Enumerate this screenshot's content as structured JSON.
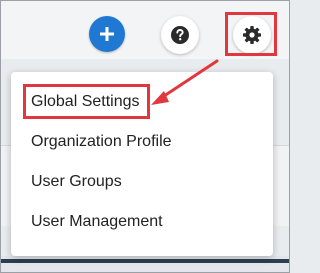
{
  "toolbar": {
    "add_icon": "plus-icon",
    "help_icon": "question-mark-icon",
    "settings_icon": "gear-icon"
  },
  "settings_menu": {
    "items": [
      {
        "label": "Global Settings"
      },
      {
        "label": "Organization Profile"
      },
      {
        "label": "User Groups"
      },
      {
        "label": "User Management"
      }
    ]
  },
  "colors": {
    "accent_blue": "#1f78d1",
    "annotation_red": "#e0383e",
    "text": "#222222"
  }
}
